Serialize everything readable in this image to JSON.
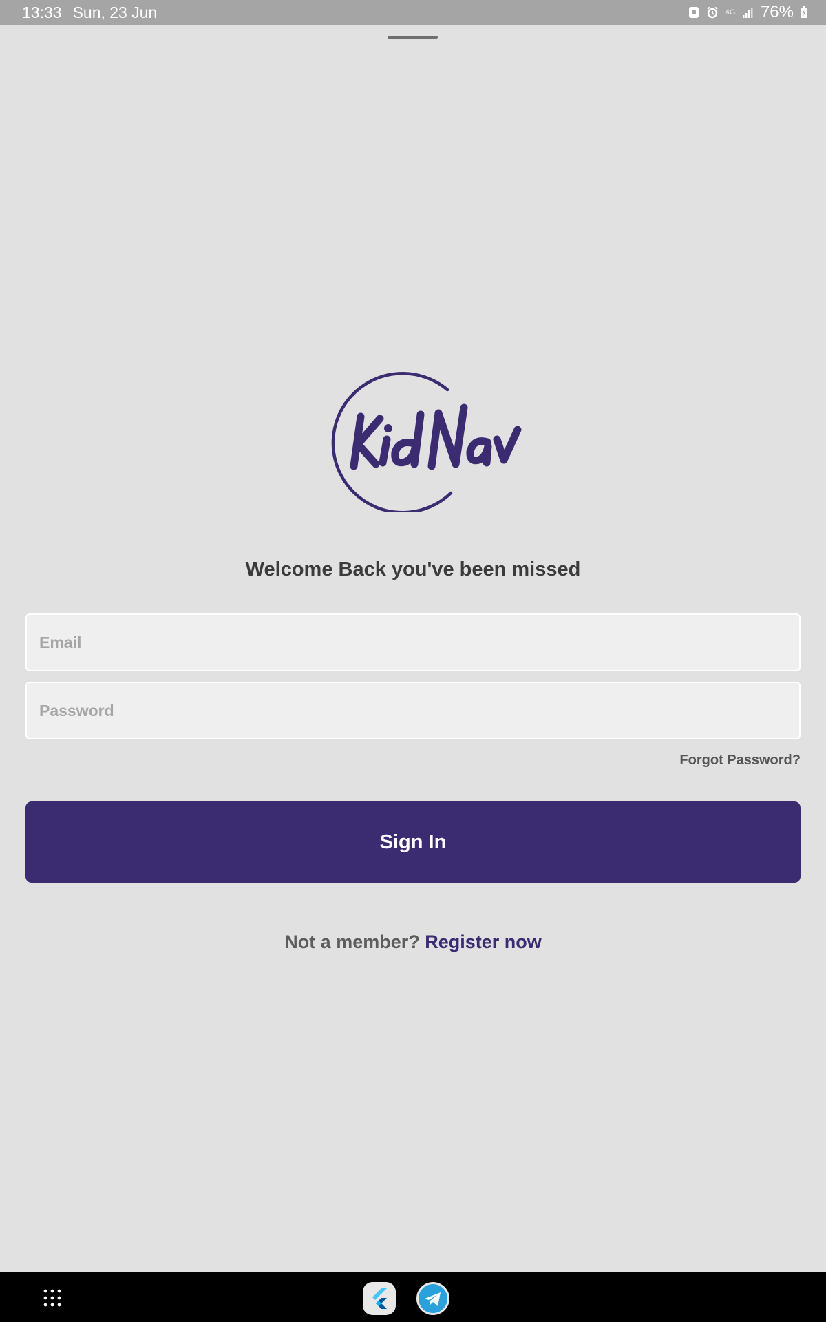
{
  "status_bar": {
    "time": "13:33",
    "date": "Sun, 23 Jun",
    "network": "4G",
    "battery": "76%",
    "icons": [
      "screenshot-icon",
      "alarm-icon",
      "network-4g-icon",
      "signal-icon",
      "battery-charging-icon"
    ]
  },
  "brand": {
    "logo_text": "KidNav",
    "color": "#3b2b71"
  },
  "login": {
    "welcome": "Welcome Back you've been missed",
    "email_placeholder": "Email",
    "email_value": "",
    "password_placeholder": "Password",
    "password_value": "",
    "forgot_password": "Forgot Password?",
    "sign_in": "Sign In",
    "register_prefix": "Not a member?",
    "register_link": "Register now"
  },
  "taskbar": {
    "apps": [
      "apps-grid-icon",
      "flutter-app-icon",
      "telegram-app-icon"
    ]
  },
  "colors": {
    "background": "#e1e1e1",
    "accent": "#3b2b71",
    "status_bar": "#a5a5a5"
  }
}
